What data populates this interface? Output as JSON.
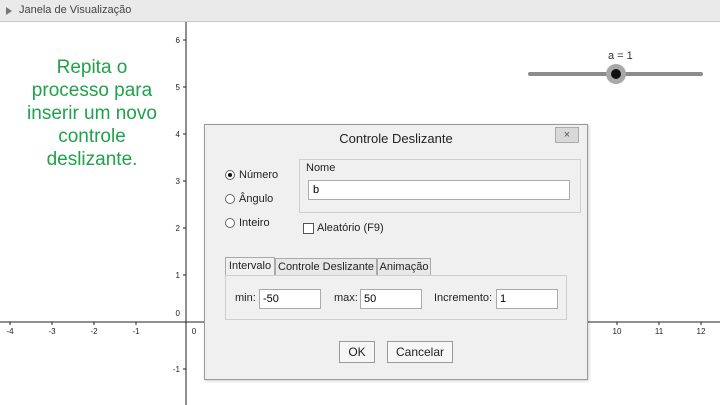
{
  "panel": {
    "title": "Janela de Visualização"
  },
  "instruction": "Repita o processo para inserir um novo controle deslizante.",
  "axes": {
    "y_ticks": [
      "6",
      "5",
      "4",
      "3",
      "2",
      "1",
      "0",
      "-1"
    ],
    "x_ticks_left": [
      "-4",
      "-3",
      "-2",
      "-1"
    ],
    "x_tick_origin": "0",
    "x_ticks_right": [
      "10",
      "11",
      "12"
    ]
  },
  "slider": {
    "label": "a = 1",
    "value_fraction": 0.5
  },
  "dialog": {
    "title": "Controle Deslizante",
    "close": "×",
    "type_options": [
      {
        "label": "Número",
        "checked": true
      },
      {
        "label": "Ângulo",
        "checked": false
      },
      {
        "label": "Inteiro",
        "checked": false
      }
    ],
    "name_label": "Nome",
    "name_value": "b",
    "random_label": "Aleatório (F9)",
    "tabs": [
      "Intervalo",
      "Controle Deslizante",
      "Animação"
    ],
    "min_label": "min:",
    "min_value": "-50",
    "max_label": "max:",
    "max_value": "50",
    "increment_label": "Incremento:",
    "increment_value": "1",
    "ok": "OK",
    "cancel": "Cancelar"
  }
}
